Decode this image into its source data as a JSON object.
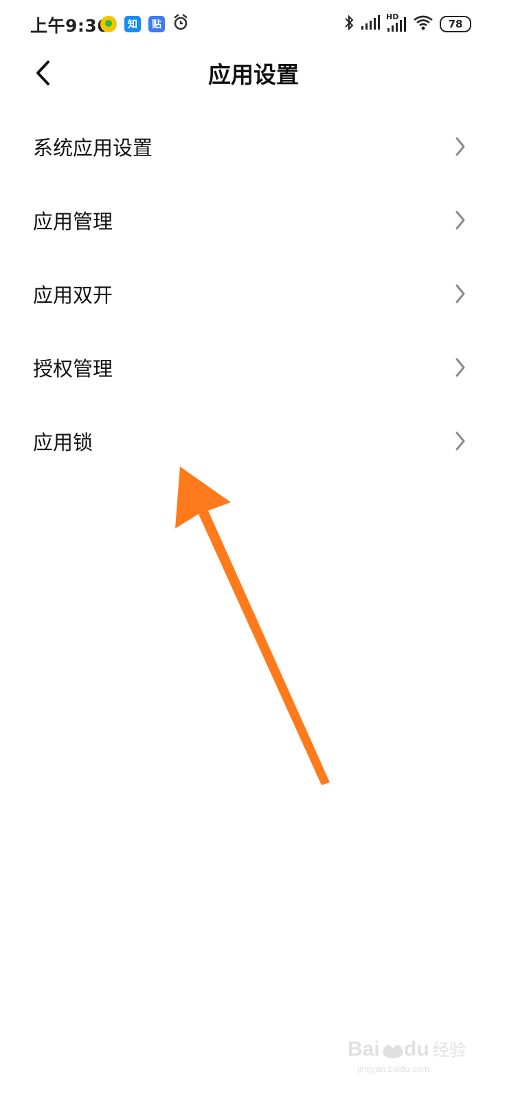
{
  "status_bar": {
    "time": "上午9:36",
    "notifications": [
      {
        "icon": "music-app-icon"
      },
      {
        "icon": "zhihu-app-icon",
        "text": "知"
      },
      {
        "icon": "tieba-app-icon",
        "text": "贴"
      },
      {
        "icon": "alarm-icon"
      }
    ],
    "battery": "78",
    "signal_label": "HD"
  },
  "header": {
    "title": "应用设置",
    "back_icon": "chevron-left-icon"
  },
  "list": {
    "items": [
      {
        "label": "系统应用设置"
      },
      {
        "label": "应用管理"
      },
      {
        "label": "应用双开"
      },
      {
        "label": "授权管理"
      },
      {
        "label": "应用锁"
      }
    ]
  },
  "annotation": {
    "arrow_color": "#ff7a1a",
    "target": "应用锁"
  },
  "watermark": {
    "brand_text": "Baidu经验",
    "url_text": "jingyan.baidu.com"
  },
  "colors": {
    "background": "#ffffff",
    "text": "#111111",
    "chevron": "#8a8a8a",
    "arrow": "#ff7a1a"
  }
}
